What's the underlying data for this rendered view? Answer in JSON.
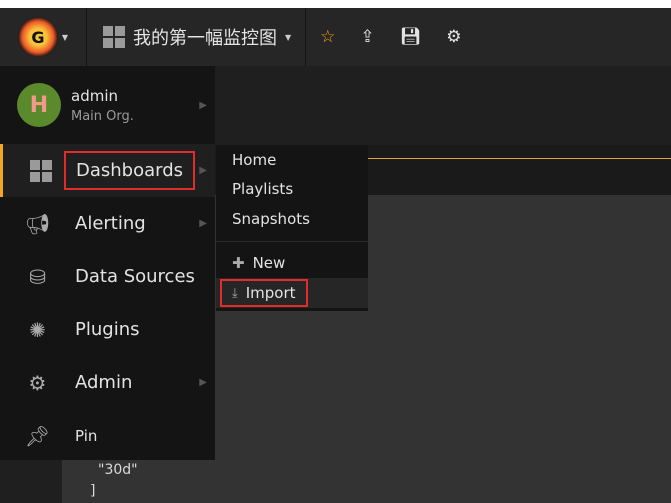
{
  "navbar": {
    "dashboard_title": "我的第一幅监控图",
    "icons": [
      "star-icon",
      "share-icon",
      "save-icon",
      "gear-icon"
    ]
  },
  "user": {
    "name": "admin",
    "org": "Main Org."
  },
  "sidemenu": [
    {
      "label": "Dashboards",
      "icon": "dashboards-grid-icon"
    },
    {
      "label": "Alerting",
      "icon": "megaphone-icon"
    },
    {
      "label": "Data Sources",
      "icon": "database-icon"
    },
    {
      "label": "Plugins",
      "icon": "plugins-icon"
    },
    {
      "label": "Admin",
      "icon": "cogs-icon"
    },
    {
      "label": "Pin",
      "icon": "pin-icon"
    }
  ],
  "submenu": {
    "items": [
      "Home",
      "Playlists",
      "Snapshots"
    ],
    "new_label": "New",
    "import_label": "Import"
  },
  "code": {
    "line1": "\"30d\"",
    "line2": "]"
  },
  "colors": {
    "accent": "#f5a623",
    "highlight": "#e02c2c"
  }
}
